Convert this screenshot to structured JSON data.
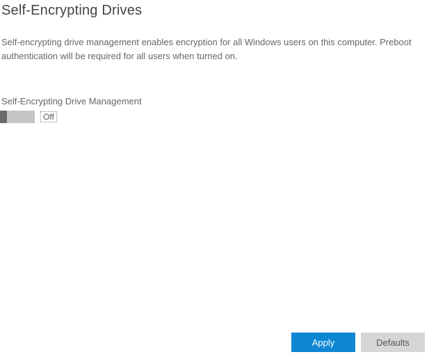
{
  "header": {
    "title": "Self-Encrypting Drives"
  },
  "main": {
    "description": "Self-encrypting drive management enables encryption for all Windows users on this computer. Preboot authentication will be required for all users when turned on.",
    "section_label": "Self-Encrypting Drive Management",
    "toggle": {
      "state_label": "Off",
      "value": false
    }
  },
  "buttons": {
    "apply_label": "Apply",
    "defaults_label": "Defaults"
  },
  "colors": {
    "primary": "#0e86d4",
    "secondary": "#d6d6d6"
  }
}
